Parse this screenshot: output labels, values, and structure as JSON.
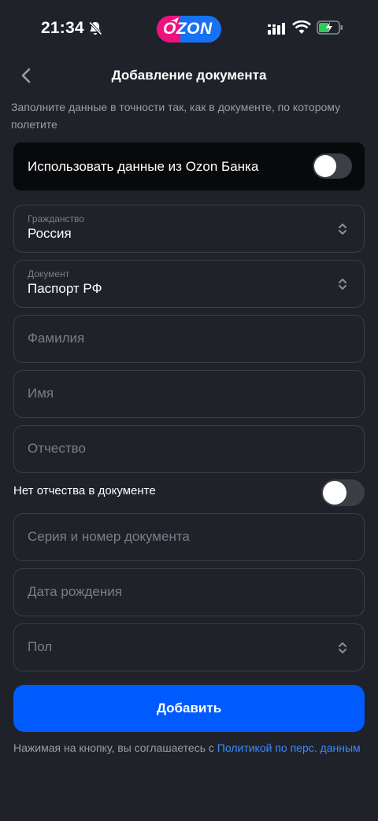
{
  "status_bar": {
    "time": "21:34",
    "logo_text": "OZON",
    "icons": [
      "bell-off-icon",
      "signal-icon",
      "wifi-icon",
      "battery-charging-icon"
    ]
  },
  "header": {
    "title": "Добавление документа",
    "back_icon": "chevron-left-icon"
  },
  "subtitle": "Заполните данные в точности так, как в документе, по которому полетите",
  "bank_toggle": {
    "label": "Использовать данные из Ozon Банка",
    "on": false
  },
  "fields": {
    "citizenship": {
      "label": "Гражданство",
      "value": "Россия"
    },
    "document": {
      "label": "Документ",
      "value": "Паспорт РФ"
    },
    "last_name": {
      "placeholder": "Фамилия"
    },
    "first_name": {
      "placeholder": "Имя"
    },
    "patronymic": {
      "placeholder": "Отчество"
    },
    "series_number": {
      "placeholder": "Серия и номер документа"
    },
    "birth_date": {
      "placeholder": "Дата рождения"
    },
    "gender": {
      "placeholder": "Пол"
    }
  },
  "no_patronymic_toggle": {
    "label": "Нет отчества в документе",
    "on": false
  },
  "add_button": {
    "label": "Добавить"
  },
  "consent": {
    "text": "Нажимая на кнопку, вы соглашаетесь  с ",
    "link": "Политикой по перс. данным"
  },
  "colors": {
    "background": "#1f2229",
    "accent": "#005bff",
    "link": "#3b8bff",
    "card": "#08090b"
  }
}
